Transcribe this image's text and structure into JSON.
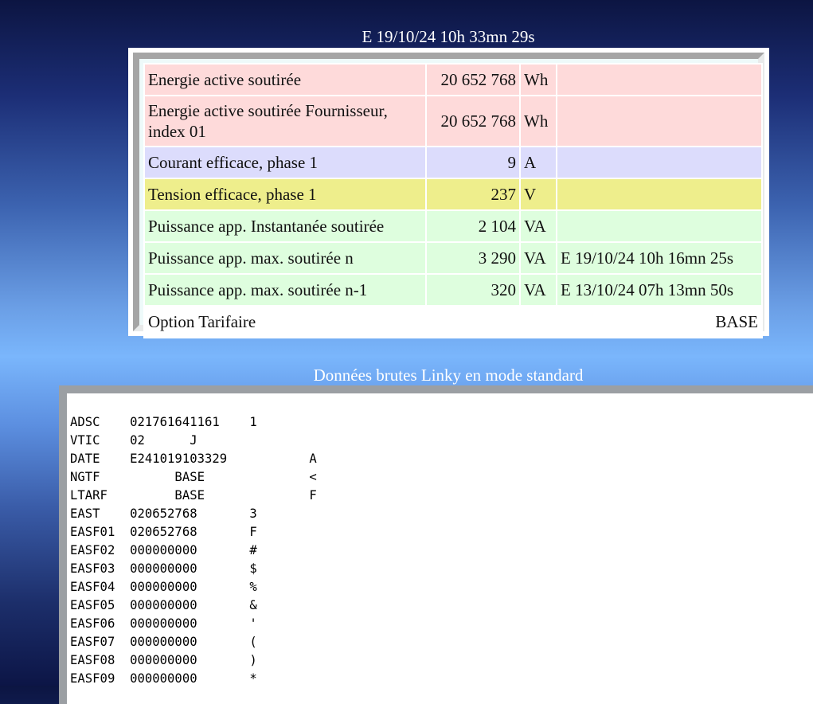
{
  "header": {
    "timestamp": "E 19/10/24 10h 33mn 29s"
  },
  "rows": [
    {
      "label": "Energie active soutirée",
      "value": "20 652 768",
      "unit": "Wh",
      "extra": ""
    },
    {
      "label": "Energie active soutirée Fournisseur, index 01",
      "value": "20 652 768",
      "unit": "Wh",
      "extra": ""
    },
    {
      "label": "Courant efficace, phase 1",
      "value": "9",
      "unit": "A",
      "extra": ""
    },
    {
      "label": "Tension efficace, phase 1",
      "value": "237",
      "unit": "V",
      "extra": ""
    },
    {
      "label": "Puissance app. Instantanée soutirée",
      "value": "2 104",
      "unit": "VA",
      "extra": ""
    },
    {
      "label": "Puissance app. max. soutirée n",
      "value": "3 290",
      "unit": "VA",
      "extra": "E 19/10/24 10h 16mn 25s"
    },
    {
      "label": "Puissance app. max. soutirée n-1",
      "value": "320",
      "unit": "VA",
      "extra": "E 13/10/24 07h 13mn 50s"
    }
  ],
  "tariff": {
    "label": "Option Tarifaire",
    "value": "BASE"
  },
  "raw_section": {
    "title": "Données brutes Linky en mode standard",
    "lines": [
      "ADSC    021761641161    1",
      "VTIC    02      J",
      "DATE    E241019103329           A",
      "NGTF          BASE              <",
      "LTARF         BASE              F",
      "EAST    020652768       3",
      "EASF01  020652768       F",
      "EASF02  000000000       #",
      "EASF03  000000000       $",
      "EASF04  000000000       %",
      "EASF05  000000000       &",
      "EASF06  000000000       '",
      "EASF07  000000000       (",
      "EASF08  000000000       )",
      "EASF09  000000000       *"
    ]
  },
  "colors": {
    "pink": "#fedada",
    "blue": "#dcdcfc",
    "yellow": "#eeee8c",
    "green": "#defede"
  }
}
